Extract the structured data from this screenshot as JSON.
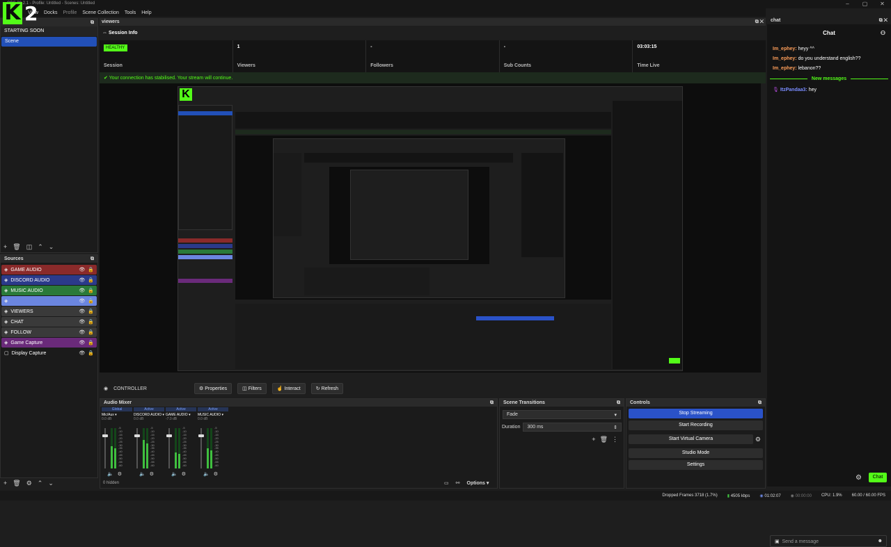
{
  "window": {
    "title": "OBS 30.2.1 - Profile: Untitled - Scenes: Untitled",
    "controls": [
      "–",
      "▢",
      "✕"
    ]
  },
  "menu": [
    "View",
    "Docks",
    "Profile",
    "Scene Collection",
    "Tools",
    "Help"
  ],
  "scenes": {
    "header": "",
    "items": [
      "STARTING SOON",
      "Scene"
    ],
    "selected": "Scene"
  },
  "sources": {
    "header": "Sources",
    "items": [
      {
        "name": "GAME AUDIO",
        "color": "#8a2a2a"
      },
      {
        "name": "DISCORD AUDIO",
        "color": "#2b3a8a"
      },
      {
        "name": "MUSIC AUDIO",
        "color": "#2a7a3a"
      },
      {
        "name": "",
        "color": "#6b86e0"
      },
      {
        "name": "VIEWERS",
        "color": "#3a3a3a"
      },
      {
        "name": "CHAT",
        "color": "#3a3a3a"
      },
      {
        "name": "FOLLOW",
        "color": "#3a3a3a"
      },
      {
        "name": "Game Capture",
        "color": "#6a2a7a"
      },
      {
        "name": "Display Capture",
        "color": "#1b1b1b"
      }
    ]
  },
  "viewers_dock": {
    "header": "viewers",
    "section": "Session Info"
  },
  "session": {
    "status": "HEALTHY",
    "cells": [
      {
        "value": "",
        "label": "Session"
      },
      {
        "value": "1",
        "label": "Viewers"
      },
      {
        "value": "-",
        "label": "Followers"
      },
      {
        "value": "-",
        "label": "Sub Counts"
      },
      {
        "value": "03:03:15",
        "label": "Time Live"
      }
    ],
    "notice": "Your connection has stabilised. Your stream will continue."
  },
  "controller": {
    "label": "CONTROLLER",
    "buttons": [
      "Properties",
      "Filters",
      "Interact",
      "Refresh"
    ]
  },
  "mixer": {
    "header": "Audio Mixer",
    "channels": [
      {
        "tag": "Global",
        "name": "Mic/Aux",
        "db": "0.0 dB",
        "level": 0.55
      },
      {
        "tag": "Active",
        "name": "DISCORD AUDIO",
        "db": "0.0 dB",
        "level": 0.7
      },
      {
        "tag": "Active",
        "name": "GAME AUDIO",
        "db": "-7.0 dB",
        "level": 0.4
      },
      {
        "tag": "Active",
        "name": "MUSIC AUDIO",
        "db": "0.0 dB",
        "level": 0.5
      }
    ],
    "ticks": [
      "-5",
      "-10",
      "-15",
      "-20",
      "-25",
      "-30",
      "-35",
      "-40",
      "-45",
      "-50",
      "-55",
      "-60"
    ],
    "hidden": "0 hidden",
    "options": "Options"
  },
  "transitions": {
    "header": "Scene Transitions",
    "transition": "Fade",
    "duration_label": "Duration",
    "duration": "300 ms"
  },
  "controls": {
    "header": "Controls",
    "buttons": [
      "Stop Streaming",
      "Start Recording",
      "Start Virtual Camera",
      "Studio Mode",
      "Settings"
    ]
  },
  "chat": {
    "tab": "chat",
    "title": "Chat",
    "messages": [
      {
        "user": "Im_ephey:",
        "text": "heyy ^^"
      },
      {
        "user": "Im_ephey:",
        "text": "do you understand english??"
      },
      {
        "user": "Im_ephey:",
        "text": "lebanon??"
      }
    ],
    "new_messages": "New messages",
    "new": [
      {
        "user": "ItzPandaa3:",
        "text": "hey"
      }
    ],
    "placeholder": "Send a message",
    "send": "Chat"
  },
  "status": {
    "dropped": "Dropped Frames 3718 (1.7%)",
    "kbps": "4505 kbps",
    "live": "01:02:07",
    "rec": "00:00:00",
    "cpu": "CPU: 1.9%",
    "fps": "60.00 / 60.00 FPS"
  },
  "colors": {
    "accent": "#53fc18",
    "blue": "#2a52c8"
  }
}
